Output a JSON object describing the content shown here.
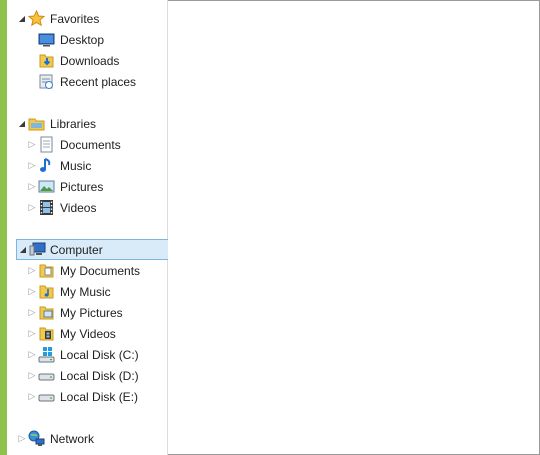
{
  "favorites": {
    "label": "Favorites",
    "items": [
      {
        "label": "Desktop",
        "icon": "desktop-icon"
      },
      {
        "label": "Downloads",
        "icon": "downloads-icon"
      },
      {
        "label": "Recent places",
        "icon": "recent-places-icon"
      }
    ]
  },
  "libraries": {
    "label": "Libraries",
    "items": [
      {
        "label": "Documents",
        "icon": "documents-icon"
      },
      {
        "label": "Music",
        "icon": "music-icon"
      },
      {
        "label": "Pictures",
        "icon": "pictures-icon"
      },
      {
        "label": "Videos",
        "icon": "videos-icon"
      }
    ]
  },
  "computer": {
    "label": "Computer",
    "selected": true,
    "items": [
      {
        "label": "My Documents",
        "icon": "my-documents-icon"
      },
      {
        "label": "My Music",
        "icon": "my-music-icon"
      },
      {
        "label": "My Pictures",
        "icon": "my-pictures-icon"
      },
      {
        "label": "My Videos",
        "icon": "my-videos-icon"
      },
      {
        "label": "Local Disk (C:)",
        "icon": "windows-drive-icon"
      },
      {
        "label": "Local Disk (D:)",
        "icon": "drive-icon"
      },
      {
        "label": "Local Disk (E:)",
        "icon": "drive-icon"
      }
    ]
  },
  "network": {
    "label": "Network",
    "icon": "network-icon"
  },
  "colors": {
    "accent_bar": "#8dc24b",
    "selection_fill": "#d9ebf9",
    "selection_border": "#7fb6df"
  }
}
